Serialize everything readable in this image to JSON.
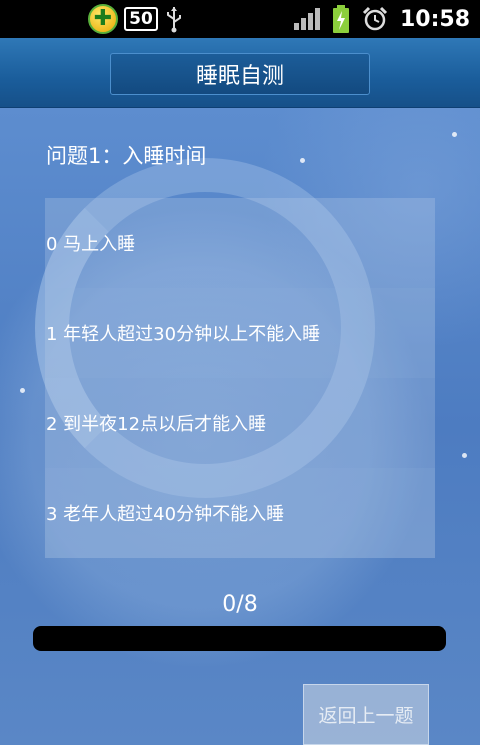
{
  "status_bar": {
    "battery_badge": "50",
    "clock": "10:58"
  },
  "header": {
    "title": "睡眠自测"
  },
  "question": {
    "text": "问题1：入睡时间"
  },
  "options": [
    {
      "label": "0 马上入睡"
    },
    {
      "label": "1 年轻人超过30分钟以上不能入睡"
    },
    {
      "label": "2 到半夜12点以后才能入睡"
    },
    {
      "label": "3 老年人超过40分钟不能入睡"
    }
  ],
  "progress": {
    "text": "0/8",
    "value": 0
  },
  "footer": {
    "back_label": "返回上一题"
  },
  "colors": {
    "title_bar": "#1a5d9b",
    "background": "#4f7fc4",
    "progress_track": "#000000"
  }
}
